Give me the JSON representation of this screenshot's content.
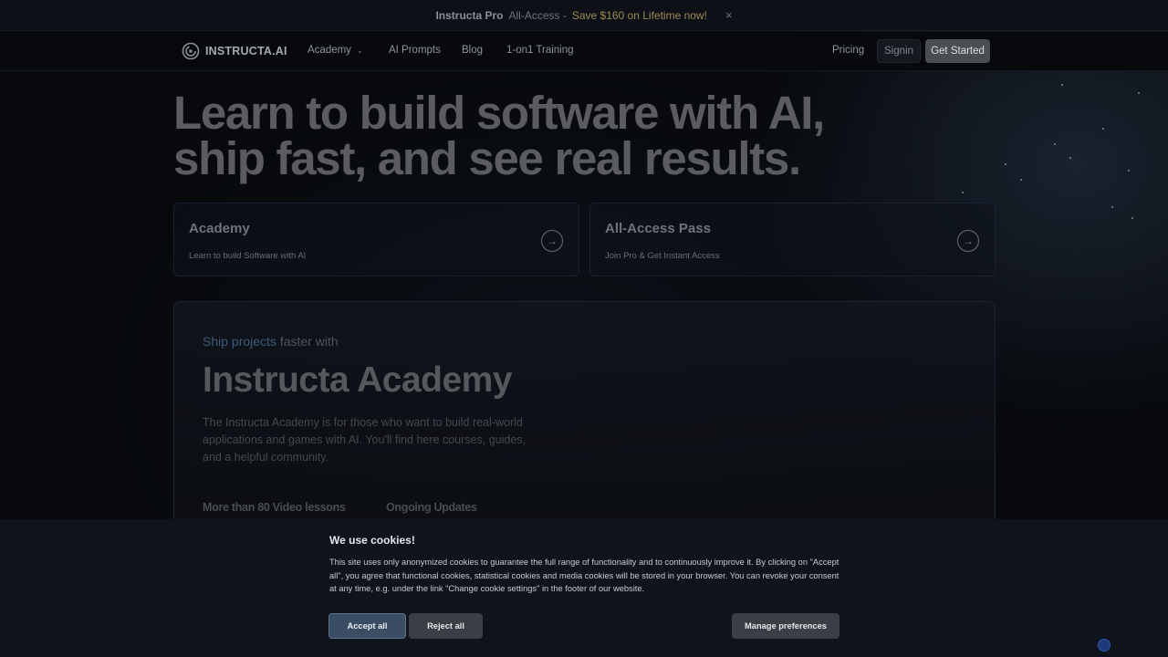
{
  "promo": {
    "brand": "Instructa Pro",
    "text": "All-Access -",
    "offer": "Save $160 on Lifetime now!",
    "close": "×"
  },
  "nav": {
    "logo_text": "INSTRUCTA.AI",
    "links": [
      "Academy",
      "AI Prompts",
      "Blog",
      "1-on1 Training"
    ],
    "pricing": "Pricing",
    "signin": "Signin",
    "get_started": "Get Started"
  },
  "hero": {
    "line1": "Learn to build software with AI,",
    "line2": "ship fast, and see real results."
  },
  "cards": [
    {
      "title": "Academy",
      "subtitle": "Learn to build Software with AI"
    },
    {
      "title": "All-Access Pass",
      "subtitle": "Join Pro & Get Instant Access"
    }
  ],
  "panel": {
    "kicker_highlight": "Ship projects",
    "kicker_rest": "faster with",
    "title": "Instructa Academy",
    "description": "The Instructa Academy is for those who want to build real-world applications and games with AI. You'll find here courses, guides, and a helpful community.",
    "features": [
      "More than 80 Video lessons",
      "Ongoing Updates"
    ]
  },
  "cookie": {
    "title": "We use cookies!",
    "text": "This site uses only anonymized cookies to guarantee the full range of functionality and to continuously improve it. By clicking on \"Accept all\", you agree that functional cookies, statistical cookies and media cookies will be stored in your browser. You can revoke your consent at any time, e.g. under the link \"Change cookie settings\" in the footer of our website.",
    "accept": "Accept all",
    "reject": "Reject all",
    "manage": "Manage preferences"
  },
  "colors": {
    "background": "#07090c",
    "cookie_bg": "#0f141c",
    "accept_button": "#3a4d62",
    "accent_gold": "#9c8a55",
    "accent_blue": "#3f5a78"
  }
}
